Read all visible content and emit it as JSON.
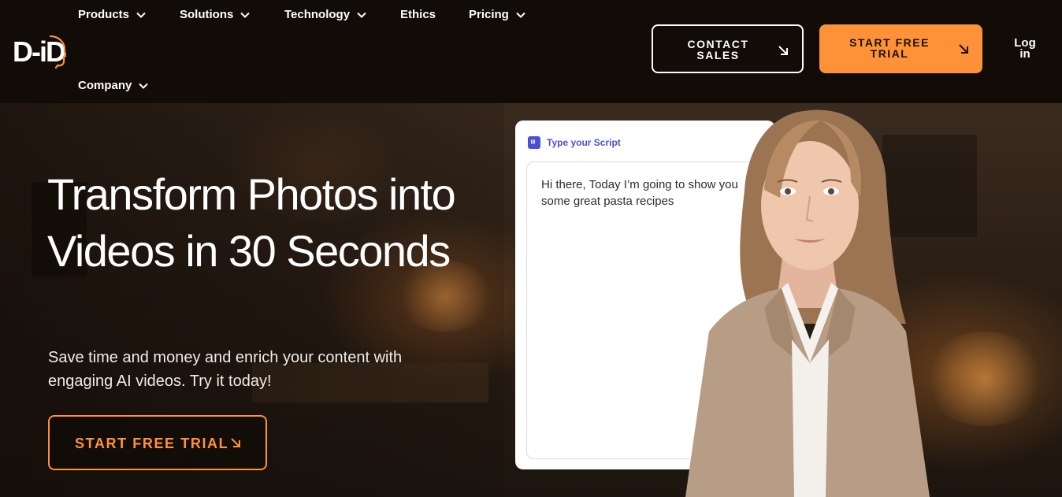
{
  "brand": {
    "logo_text": "D-iD",
    "accent_color": "#ff9239"
  },
  "nav": {
    "items": [
      {
        "label": "Products",
        "has_dropdown": true
      },
      {
        "label": "Solutions",
        "has_dropdown": true
      },
      {
        "label": "Technology",
        "has_dropdown": true
      },
      {
        "label": "Ethics",
        "has_dropdown": false
      },
      {
        "label": "Pricing",
        "has_dropdown": true
      },
      {
        "label": "Company",
        "has_dropdown": true
      }
    ],
    "contact_sales": "CONTACT\nSALES",
    "start_free_trial": "START FREE\nTRIAL",
    "login": "Log\nin"
  },
  "hero": {
    "title": "Transform Photos into Videos in 30 Seconds",
    "subtitle": "Save time and money and enrich your content with engaging AI videos. Try it today!",
    "cta": "START FREE TRIAL"
  },
  "script_card": {
    "header": "Type your Script",
    "text": "Hi there, Today I’m going to show you some great pasta recipes"
  }
}
